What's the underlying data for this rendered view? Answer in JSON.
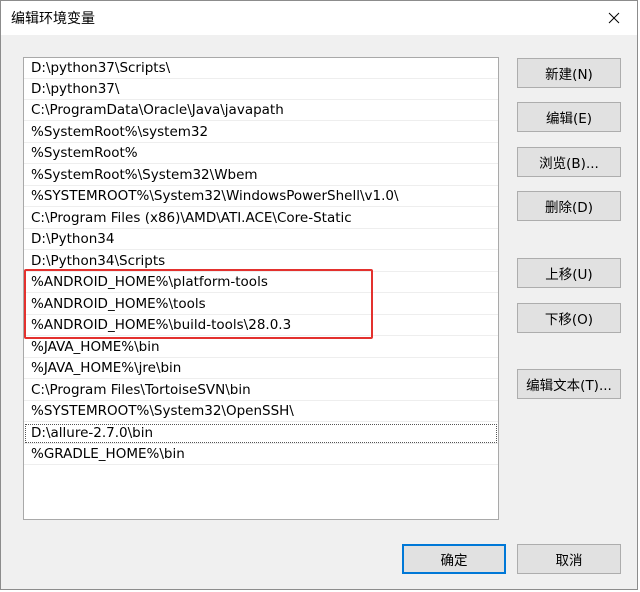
{
  "window": {
    "title": "编辑环境变量"
  },
  "list": {
    "items": [
      "D:\\python37\\Scripts\\",
      "D:\\python37\\",
      "C:\\ProgramData\\Oracle\\Java\\javapath",
      "%SystemRoot%\\system32",
      "%SystemRoot%",
      "%SystemRoot%\\System32\\Wbem",
      "%SYSTEMROOT%\\System32\\WindowsPowerShell\\v1.0\\",
      "C:\\Program Files (x86)\\AMD\\ATI.ACE\\Core-Static",
      "D:\\Python34",
      "D:\\Python34\\Scripts",
      "%ANDROID_HOME%\\platform-tools",
      "%ANDROID_HOME%\\tools",
      "%ANDROID_HOME%\\build-tools\\28.0.3",
      "%JAVA_HOME%\\bin",
      "%JAVA_HOME%\\jre\\bin",
      "C:\\Program Files\\TortoiseSVN\\bin",
      "%SYSTEMROOT%\\System32\\OpenSSH\\",
      "D:\\allure-2.7.0\\bin",
      "%GRADLE_HOME%\\bin"
    ]
  },
  "buttons": {
    "new": "新建(N)",
    "edit": "编辑(E)",
    "browse": "浏览(B)...",
    "delete": "删除(D)",
    "move_up": "上移(U)",
    "move_down": "下移(O)",
    "edit_text": "编辑文本(T)...",
    "ok": "确定",
    "cancel": "取消"
  },
  "colors": {
    "highlight_border": "#e3312e",
    "default_button_border": "#0078d7"
  }
}
